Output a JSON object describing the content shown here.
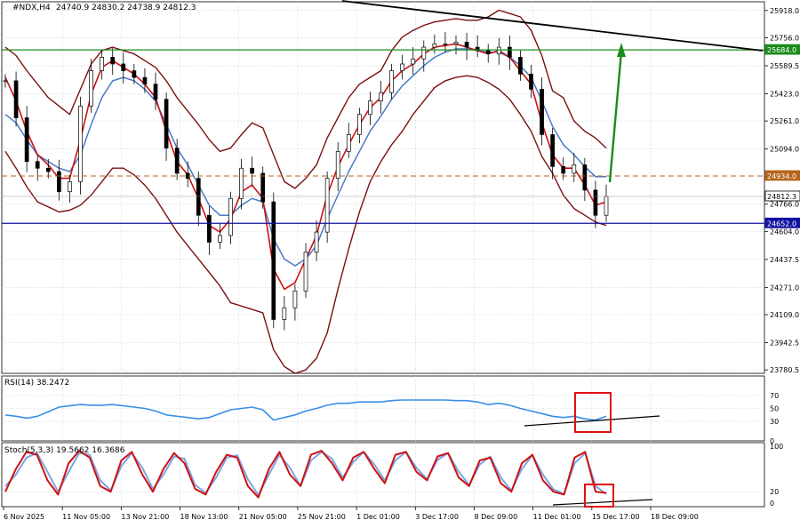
{
  "chart_data": {
    "type": "line",
    "symbol": "#NDX,H4",
    "ohlc_readout": "24740.9 24830.2 24738.9 24812.3",
    "x_tick_labels": [
      "6 Nov 2025",
      "11 Nov 05:00",
      "13 Nov 21:00",
      "18 Nov 13:00",
      "21 Nov 05:00",
      "25 Nov 21:00",
      "1 Dec 01:00",
      "3 Dec 17:00",
      "8 Dec 09:00",
      "11 Dec 01:00",
      "15 Dec 17:00",
      "18 Dec 09:00"
    ],
    "main_panel": {
      "y_ticks": [
        25918.0,
        25756.0,
        25589.5,
        25423.0,
        25261.0,
        25094.0,
        24766.0,
        24604.0,
        24437.5,
        24271.0,
        24109.0,
        23942.5,
        23780.5
      ],
      "ylim": [
        23760,
        25970
      ],
      "horizontal_levels": [
        {
          "label": "25684.0",
          "value": 25684.0,
          "color": "#1a8c1a",
          "style": "solid"
        },
        {
          "label": "24934.0",
          "value": 24934.0,
          "color": "#b5651d",
          "style": "dashed"
        },
        {
          "label": "24812.3",
          "value": 24812.3,
          "color": "#000000",
          "style": "price"
        },
        {
          "label": "24652.0",
          "value": 24652.0,
          "color": "#1010a0",
          "style": "solid"
        }
      ],
      "close_series": [
        25500,
        25280,
        25020,
        24980,
        24960,
        24840,
        24900,
        25350,
        25560,
        25640,
        25600,
        25560,
        25520,
        25480,
        25390,
        25100,
        24950,
        24920,
        24700,
        24540,
        24580,
        24800,
        24980,
        24950,
        24780,
        24080,
        24150,
        24250,
        24480,
        24600,
        24920,
        25080,
        25180,
        25300,
        25380,
        25430,
        25560,
        25600,
        25630,
        25700,
        25720,
        25720,
        25730,
        25700,
        25680,
        25660,
        25700,
        25640,
        25540,
        25450,
        25180,
        24990,
        24950,
        25000,
        24850,
        24700,
        24812
      ],
      "moving_average_fast": [
        25520,
        25380,
        25200,
        25060,
        25000,
        24920,
        24920,
        25150,
        25420,
        25580,
        25620,
        25580,
        25540,
        25480,
        25400,
        25200,
        25020,
        24940,
        24800,
        24640,
        24600,
        24680,
        24840,
        24880,
        24800,
        24380,
        24260,
        24300,
        24440,
        24580,
        24820,
        24990,
        25120,
        25240,
        25340,
        25400,
        25500,
        25560,
        25600,
        25660,
        25700,
        25710,
        25720,
        25700,
        25680,
        25660,
        25680,
        25640,
        25560,
        25480,
        25250,
        25060,
        24980,
        24980,
        24880,
        24760,
        24780
      ],
      "moving_average_slow": [
        25300,
        25250,
        25150,
        25060,
        25020,
        24980,
        24960,
        25060,
        25240,
        25400,
        25500,
        25520,
        25500,
        25450,
        25380,
        25240,
        25100,
        25000,
        24880,
        24760,
        24700,
        24700,
        24760,
        24800,
        24780,
        24560,
        24440,
        24400,
        24440,
        24520,
        24680,
        24820,
        24960,
        25080,
        25200,
        25290,
        25390,
        25470,
        25530,
        25590,
        25640,
        25670,
        25690,
        25690,
        25680,
        25670,
        25670,
        25640,
        25590,
        25520,
        25380,
        25230,
        25120,
        25060,
        24990,
        24930,
        24930
      ],
      "bollinger_upper": [
        25700,
        25650,
        25560,
        25480,
        25400,
        25350,
        25300,
        25450,
        25600,
        25680,
        25700,
        25680,
        25660,
        25620,
        25580,
        25500,
        25400,
        25320,
        25240,
        25150,
        25080,
        25100,
        25180,
        25250,
        25220,
        25060,
        24900,
        24860,
        24920,
        25000,
        25160,
        25280,
        25400,
        25480,
        25520,
        25560,
        25680,
        25760,
        25800,
        25830,
        25850,
        25860,
        25870,
        25860,
        25860,
        25880,
        25920,
        25900,
        25880,
        25800,
        25650,
        25440,
        25400,
        25260,
        25200,
        25160,
        25100
      ],
      "bollinger_lower": [
        25080,
        24980,
        24870,
        24780,
        24750,
        24720,
        24730,
        24760,
        24820,
        24900,
        24980,
        24980,
        24940,
        24880,
        24800,
        24700,
        24600,
        24520,
        24440,
        24360,
        24280,
        24180,
        24160,
        24140,
        24120,
        23900,
        23800,
        23760,
        23780,
        23850,
        24000,
        24260,
        24500,
        24720,
        24900,
        25020,
        25120,
        25200,
        25300,
        25380,
        25460,
        25500,
        25520,
        25530,
        25520,
        25490,
        25450,
        25390,
        25300,
        25200,
        25050,
        24950,
        24820,
        24740,
        24700,
        24660,
        24640
      ]
    },
    "rsi_panel": {
      "label": "RSI(14) 38.2472",
      "y_ticks": [
        "70",
        "50",
        "30",
        "0"
      ],
      "ylim": [
        0,
        100
      ],
      "values": [
        40,
        38,
        35,
        38,
        45,
        52,
        54,
        56,
        55,
        55,
        56,
        54,
        52,
        50,
        46,
        40,
        38,
        36,
        34,
        36,
        42,
        48,
        50,
        52,
        48,
        32,
        36,
        40,
        46,
        50,
        55,
        58,
        58,
        60,
        60,
        60,
        62,
        63,
        63,
        63,
        63,
        63,
        62,
        62,
        60,
        56,
        58,
        55,
        50,
        46,
        42,
        38,
        36,
        38,
        34,
        32,
        38
      ]
    },
    "stoch_panel": {
      "label": "Stoch(5,3,3) 19.5662 16.3686",
      "y_ticks": [
        "100",
        "20",
        "0"
      ],
      "ylim": [
        0,
        100
      ],
      "main_values": [
        20,
        60,
        90,
        85,
        40,
        15,
        70,
        92,
        80,
        30,
        20,
        75,
        90,
        50,
        20,
        60,
        88,
        70,
        25,
        15,
        55,
        85,
        80,
        30,
        10,
        60,
        90,
        50,
        30,
        85,
        92,
        70,
        40,
        80,
        90,
        60,
        35,
        85,
        90,
        55,
        40,
        82,
        88,
        45,
        30,
        75,
        80,
        35,
        20,
        70,
        85,
        40,
        20,
        15,
        80,
        90,
        20,
        18
      ],
      "signal_values": [
        30,
        50,
        80,
        88,
        55,
        20,
        55,
        88,
        85,
        40,
        22,
        65,
        88,
        62,
        25,
        50,
        82,
        78,
        32,
        18,
        45,
        80,
        84,
        42,
        14,
        50,
        85,
        62,
        30,
        75,
        90,
        78,
        45,
        72,
        90,
        68,
        40,
        75,
        90,
        62,
        42,
        76,
        88,
        55,
        32,
        68,
        82,
        45,
        22,
        60,
        84,
        50,
        24,
        16,
        70,
        88,
        30,
        16
      ]
    },
    "trendlines": {
      "main_resistance": {
        "color": "#000000"
      },
      "rsi_support": {
        "color": "#000000"
      },
      "stoch_support": {
        "color": "#000000"
      }
    },
    "annotations": [
      {
        "type": "arrow",
        "color": "#1a8c1a",
        "direction": "up"
      },
      {
        "type": "box",
        "color": "#e01010",
        "panel": "rsi"
      },
      {
        "type": "box",
        "color": "#e01010",
        "panel": "stoch"
      }
    ],
    "colors": {
      "price": "#000000",
      "ma_fast": "#cc1010",
      "ma_slow": "#4a7ac8",
      "bollinger": "#7a1010",
      "rsi": "#3a8ee6",
      "stoch_main": "#d01010",
      "stoch_signal": "#7aa6e6",
      "grid": "#cfd6dc"
    }
  }
}
